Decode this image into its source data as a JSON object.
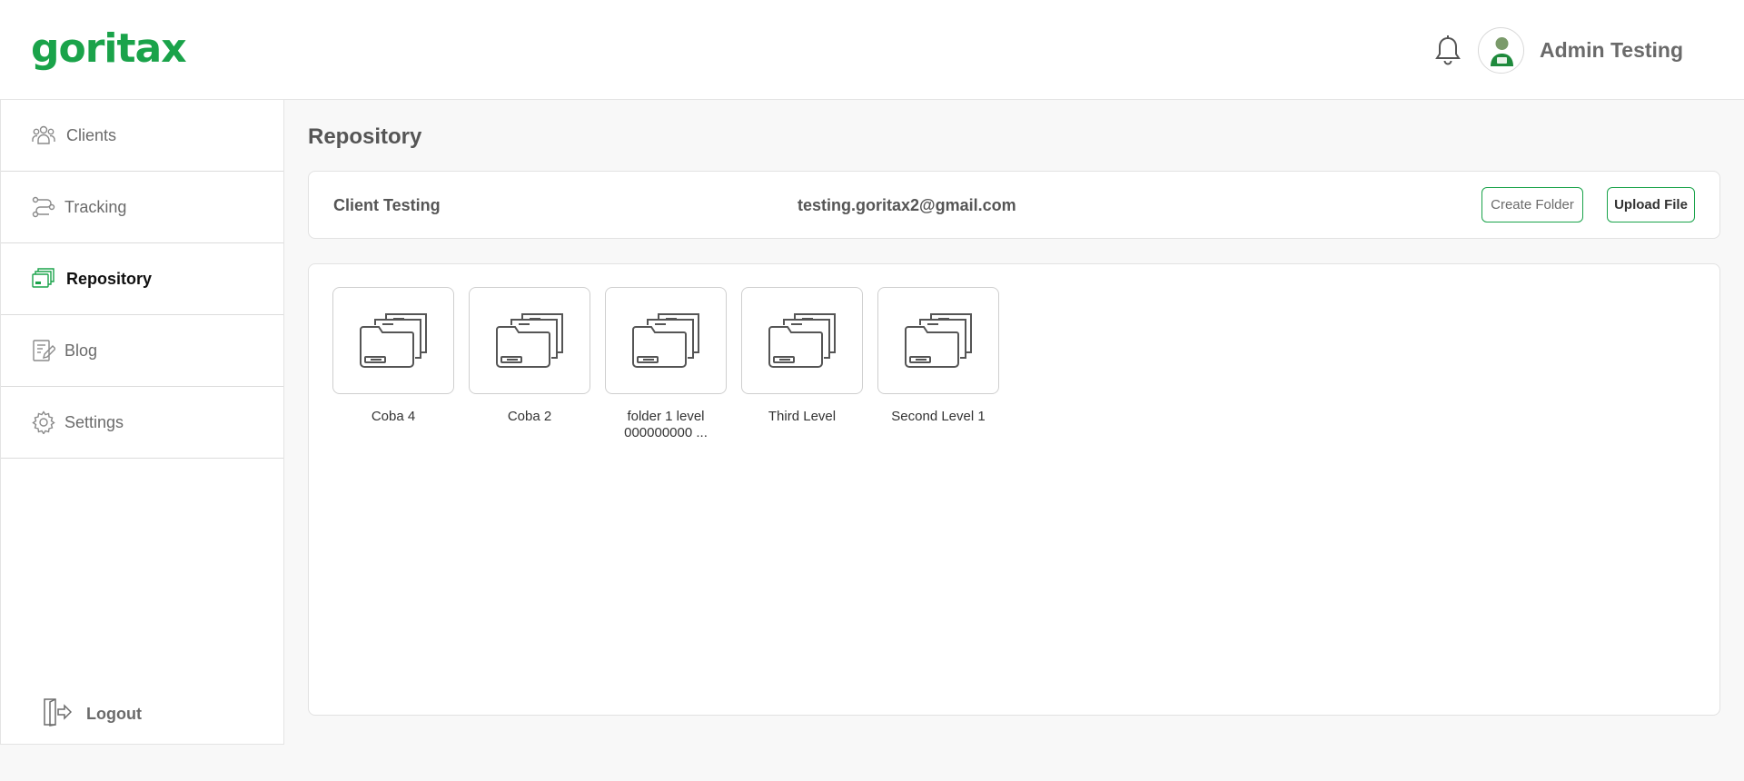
{
  "header": {
    "logo_text": "goritax",
    "user_name": "Admin Testing",
    "icons": {
      "notifications": "bell-icon",
      "avatar": "user-avatar"
    }
  },
  "sidebar": {
    "items": [
      {
        "label": "Clients",
        "icon": "clients-icon",
        "active": false
      },
      {
        "label": "Tracking",
        "icon": "tracking-icon",
        "active": false
      },
      {
        "label": "Repository",
        "icon": "repository-icon",
        "active": true
      },
      {
        "label": "Blog",
        "icon": "blog-icon",
        "active": false
      },
      {
        "label": "Settings",
        "icon": "gear-icon",
        "active": false
      }
    ],
    "logout_label": "Logout"
  },
  "main": {
    "title": "Repository",
    "client": {
      "name": "Client Testing",
      "email": "testing.goritax2@gmail.com",
      "create_folder_label": "Create Folder",
      "upload_file_label": "Upload File"
    },
    "folders": [
      {
        "name": "Coba 4"
      },
      {
        "name": "Coba 2"
      },
      {
        "name": "folder 1 level 000000000 ..."
      },
      {
        "name": "Third Level"
      },
      {
        "name": "Second Level 1"
      }
    ]
  },
  "colors": {
    "brand_green": "#1aa34a",
    "background": "#f8f8f8",
    "card": "#ffffff"
  }
}
